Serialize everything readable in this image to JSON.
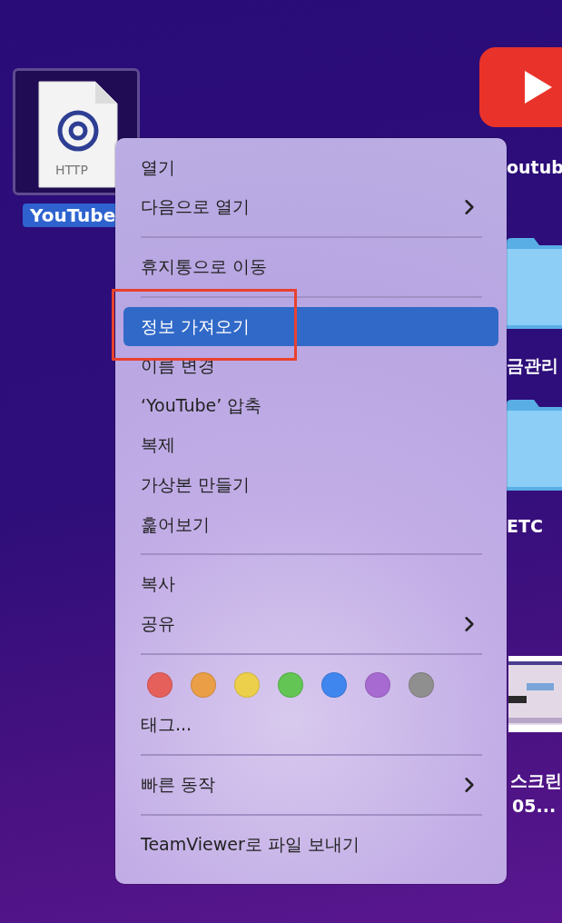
{
  "desktop": {
    "file": {
      "label": "YouTube",
      "icon_text": "HTTP",
      "selected": true
    },
    "items": [
      {
        "kind": "app",
        "label": "outub"
      },
      {
        "kind": "folder",
        "label": "금관리"
      },
      {
        "kind": "folder",
        "label": "ETC"
      },
      {
        "kind": "screenshot",
        "label": "스크린",
        "label_2": "05..."
      }
    ]
  },
  "context_menu": {
    "items": [
      {
        "kind": "item",
        "label": "열기",
        "selected": false,
        "submenu": false
      },
      {
        "kind": "item",
        "label": "다음으로 열기",
        "selected": false,
        "submenu": true
      },
      {
        "kind": "separator"
      },
      {
        "kind": "item",
        "label": "휴지통으로 이동",
        "selected": false,
        "submenu": false
      },
      {
        "kind": "separator"
      },
      {
        "kind": "item",
        "label": "정보 가져오기",
        "selected": true,
        "submenu": false
      },
      {
        "kind": "item",
        "label": "이름 변경",
        "selected": false,
        "submenu": false
      },
      {
        "kind": "item",
        "label": "‘YouTube’ 압축",
        "selected": false,
        "submenu": false
      },
      {
        "kind": "item",
        "label": "복제",
        "selected": false,
        "submenu": false
      },
      {
        "kind": "item",
        "label": "가상본 만들기",
        "selected": false,
        "submenu": false
      },
      {
        "kind": "item",
        "label": "훑어보기",
        "selected": false,
        "submenu": false
      },
      {
        "kind": "separator"
      },
      {
        "kind": "item",
        "label": "복사",
        "selected": false,
        "submenu": false
      },
      {
        "kind": "item",
        "label": "공유",
        "selected": false,
        "submenu": true
      },
      {
        "kind": "separator"
      },
      {
        "kind": "tags",
        "tags": [
          {
            "color": "#e5605a"
          },
          {
            "color": "#ea9e45"
          },
          {
            "color": "#eccf4a"
          },
          {
            "color": "#62c554"
          },
          {
            "color": "#3f86ef"
          },
          {
            "color": "#a66ad1"
          },
          {
            "color": "#8f8f8f"
          }
        ]
      },
      {
        "kind": "item",
        "label": "태그...",
        "selected": false,
        "submenu": false
      },
      {
        "kind": "separator"
      },
      {
        "kind": "item",
        "label": "빠른 동작",
        "selected": false,
        "submenu": true
      },
      {
        "kind": "separator"
      },
      {
        "kind": "item",
        "label": "TeamViewer로 파일 보내기",
        "selected": false,
        "submenu": false
      }
    ]
  }
}
